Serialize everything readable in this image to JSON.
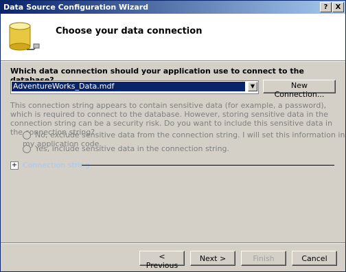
{
  "window": {
    "title": "Data Source Configuration Wizard",
    "help_glyph": "?",
    "close_glyph": "X"
  },
  "header": {
    "title": "Choose your data connection",
    "icon": "database-connection-icon"
  },
  "connection": {
    "question": "Which data connection should your application use to connect to the database?",
    "selected": "AdventureWorks_Data.mdf",
    "new_connection_label": "New Connection...",
    "dropdown_glyph": "▼"
  },
  "sensitive": {
    "info": "This connection string appears to contain sensitive data (for example, a password), which is required to connect to the database. However, storing sensitive data in the connection string can be a security risk. Do you want to include this sensitive data in the connection string?",
    "option_no": "No, exclude sensitive data from the connection string. I will set this information in my application code.",
    "option_yes": "Yes, include sensitive data in the connection string."
  },
  "connection_string": {
    "expander_glyph": "+",
    "label": "Connection string"
  },
  "footer": {
    "previous_label": "< Previous",
    "next_label": "Next >",
    "finish_label": "Finish",
    "cancel_label": "Cancel"
  }
}
